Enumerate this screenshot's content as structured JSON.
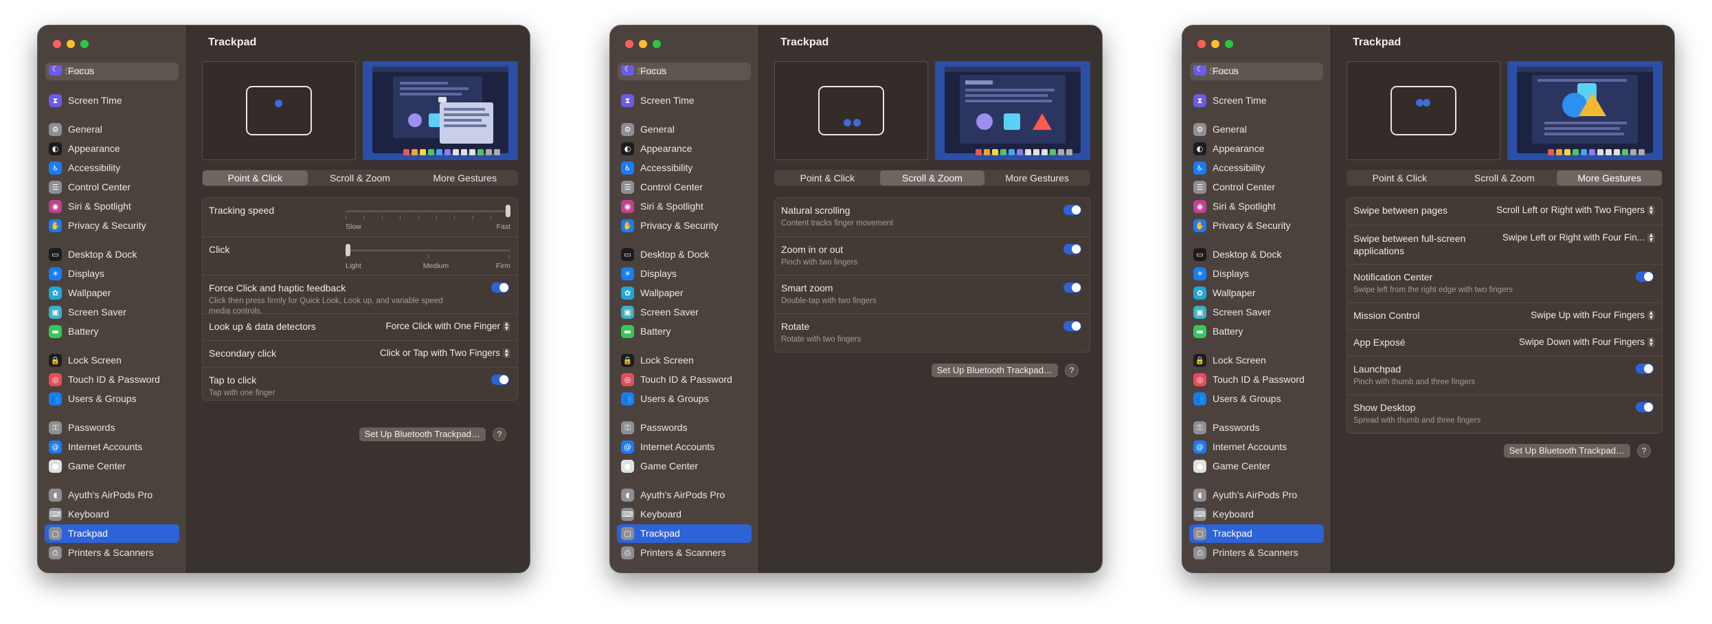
{
  "sidebar": {
    "search_placeholder": "Search",
    "items": [
      {
        "label": "Focus",
        "icon": "focus-icon"
      },
      {
        "label": "Screen Time",
        "icon": "hourglass-icon"
      },
      {
        "label": "General",
        "icon": "gear-icon"
      },
      {
        "label": "Appearance",
        "icon": "appearance-icon"
      },
      {
        "label": "Accessibility",
        "icon": "accessibility-icon"
      },
      {
        "label": "Control Center",
        "icon": "control-center-icon"
      },
      {
        "label": "Siri & Spotlight",
        "icon": "siri-icon"
      },
      {
        "label": "Privacy & Security",
        "icon": "hand-icon"
      },
      {
        "label": "Desktop & Dock",
        "icon": "dock-icon"
      },
      {
        "label": "Displays",
        "icon": "sun-icon"
      },
      {
        "label": "Wallpaper",
        "icon": "flower-icon"
      },
      {
        "label": "Screen Saver",
        "icon": "screen-saver-icon"
      },
      {
        "label": "Battery",
        "icon": "battery-icon"
      },
      {
        "label": "Lock Screen",
        "icon": "lock-icon"
      },
      {
        "label": "Touch ID & Password",
        "icon": "fingerprint-icon"
      },
      {
        "label": "Users & Groups",
        "icon": "users-icon"
      },
      {
        "label": "Passwords",
        "icon": "key-icon"
      },
      {
        "label": "Internet Accounts",
        "icon": "at-icon"
      },
      {
        "label": "Game Center",
        "icon": "game-center-icon"
      },
      {
        "label": "Ayuth’s AirPods Pro",
        "icon": "airpods-icon"
      },
      {
        "label": "Keyboard",
        "icon": "keyboard-icon"
      },
      {
        "label": "Trackpad",
        "icon": "trackpad-icon"
      },
      {
        "label": "Printers & Scanners",
        "icon": "printer-icon"
      }
    ],
    "selected": "Trackpad"
  },
  "title": "Trackpad",
  "tabs": [
    "Point & Click",
    "Scroll & Zoom",
    "More Gestures"
  ],
  "setup_button": "Set Up Bluetooth Trackpad…",
  "help_label": "?",
  "accent_color": "#2d63d9",
  "point_click": {
    "tracking_speed": {
      "label": "Tracking speed",
      "min_label": "Slow",
      "max_label": "Fast",
      "value": 1.0
    },
    "click": {
      "label": "Click",
      "labels": [
        "Light",
        "Medium",
        "Firm"
      ],
      "value": 0.0
    },
    "force_click": {
      "label": "Force Click and haptic feedback",
      "sub": "Click then press firmly for Quick Look, Look up, and variable speed media controls.",
      "on": true
    },
    "lookup": {
      "label": "Look up & data detectors",
      "value": "Force Click with One Finger"
    },
    "secondary": {
      "label": "Secondary click",
      "value": "Click or Tap with Two Fingers"
    },
    "tap": {
      "label": "Tap to click",
      "sub": "Tap with one finger",
      "on": true
    }
  },
  "scroll_zoom": [
    {
      "label": "Natural scrolling",
      "sub": "Content tracks finger movement",
      "on": true
    },
    {
      "label": "Zoom in or out",
      "sub": "Pinch with two fingers",
      "on": true
    },
    {
      "label": "Smart zoom",
      "sub": "Double-tap with two fingers",
      "on": true
    },
    {
      "label": "Rotate",
      "sub": "Rotate with two fingers",
      "on": true
    }
  ],
  "more_gestures": {
    "swipe_pages": {
      "label": "Swipe between pages",
      "value": "Scroll Left or Right with Two Fingers"
    },
    "swipe_apps": {
      "label": "Swipe between full-screen applications",
      "value": "Swipe Left or Right with Four Fin..."
    },
    "notification": {
      "label": "Notification Center",
      "sub": "Swipe left from the right edge with two fingers",
      "on": true
    },
    "mission": {
      "label": "Mission Control",
      "value": "Swipe Up with Four Fingers"
    },
    "expose": {
      "label": "App Exposé",
      "value": "Swipe Down with Four Fingers"
    },
    "launchpad": {
      "label": "Launchpad",
      "sub": "Pinch with thumb and three fingers",
      "on": true
    },
    "desktop": {
      "label": "Show Desktop",
      "sub": "Spread with thumb and three fingers",
      "on": true
    }
  }
}
